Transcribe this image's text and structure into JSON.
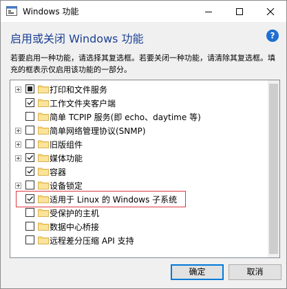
{
  "window": {
    "title": "Windows 功能"
  },
  "main": {
    "heading": "启用或关闭 Windows 功能",
    "description": "若要启用一种功能，请选择其复选框。若要关闭一种功能，请清除其复选框。填充的框表示仅启用该功能的一部分。"
  },
  "features": [
    {
      "label": "打印和文件服务",
      "state": "partial",
      "expandable": true
    },
    {
      "label": "工作文件夹客户端",
      "state": "checked",
      "expandable": false
    },
    {
      "label": "简单 TCPIP 服务(即 echo、daytime 等)",
      "state": "unchecked",
      "expandable": false
    },
    {
      "label": "简单网络管理协议(SNMP)",
      "state": "unchecked",
      "expandable": true
    },
    {
      "label": "旧版组件",
      "state": "unchecked",
      "expandable": true
    },
    {
      "label": "媒体功能",
      "state": "checked",
      "expandable": true
    },
    {
      "label": "容器",
      "state": "checked",
      "expandable": false
    },
    {
      "label": "设备锁定",
      "state": "unchecked",
      "expandable": true
    },
    {
      "label": "适用于 Linux 的 Windows 子系统",
      "state": "checked",
      "expandable": false,
      "highlighted": true
    },
    {
      "label": "受保护的主机",
      "state": "unchecked",
      "expandable": false
    },
    {
      "label": "数据中心桥接",
      "state": "unchecked",
      "expandable": false
    },
    {
      "label": "远程差分压缩 API 支持",
      "state": "unchecked",
      "expandable": false
    }
  ],
  "buttons": {
    "ok": "确定",
    "cancel": "取消"
  },
  "colors": {
    "heading": "#1c3f94",
    "highlight_border": "#d9363e",
    "folder": "#f8d775",
    "focus_border": "#0078d7"
  }
}
